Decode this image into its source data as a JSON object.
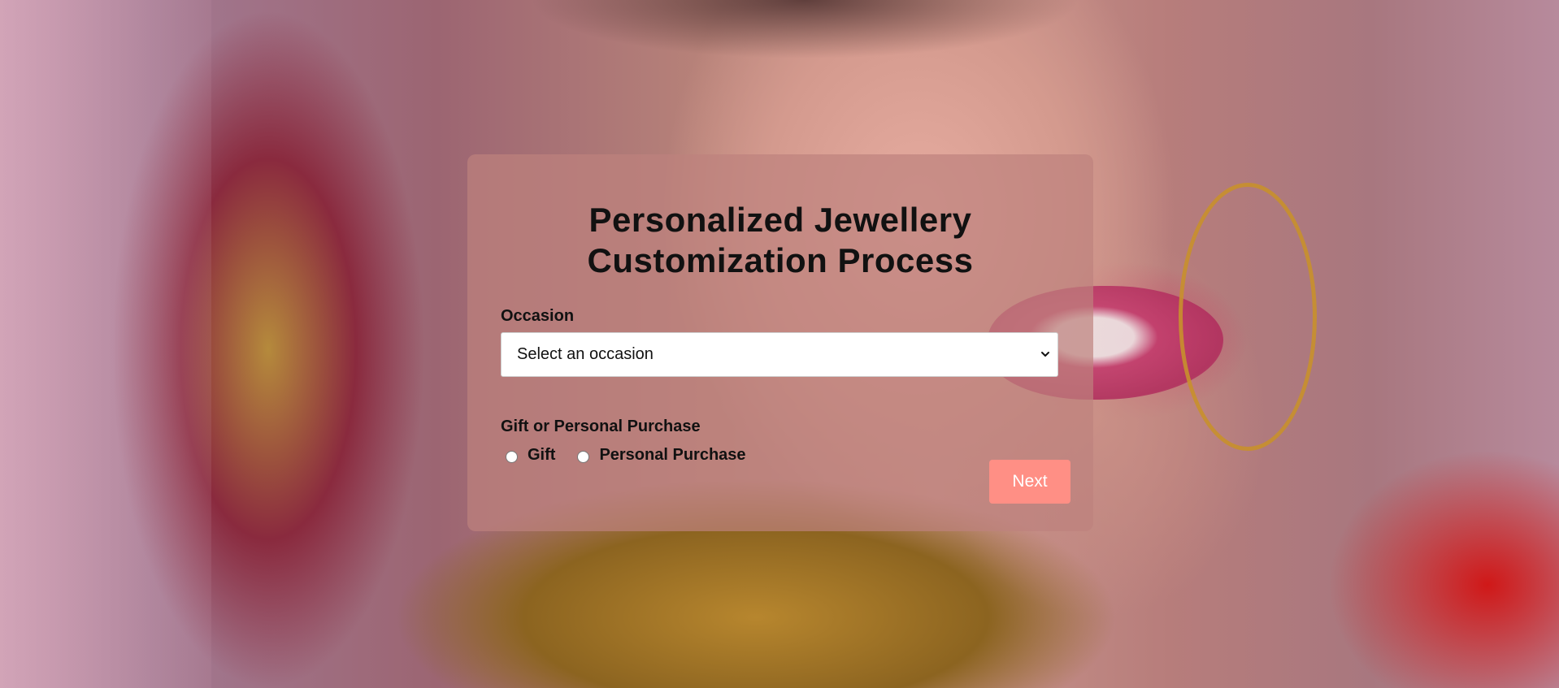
{
  "form": {
    "title_line1": "Personalized Jewellery",
    "title_line2": "Customization Process",
    "occasion": {
      "label": "Occasion",
      "selected": "Select an occasion"
    },
    "purchase_type": {
      "label": "Gift or Personal Purchase",
      "options": [
        "Gift",
        "Personal Purchase"
      ],
      "selected": null
    },
    "next_label": "Next"
  },
  "colors": {
    "card_background": "#be827d",
    "next_button": "#ff8f85",
    "text": "#111111"
  },
  "icons": {
    "select_arrow": "chevron-down-icon"
  }
}
